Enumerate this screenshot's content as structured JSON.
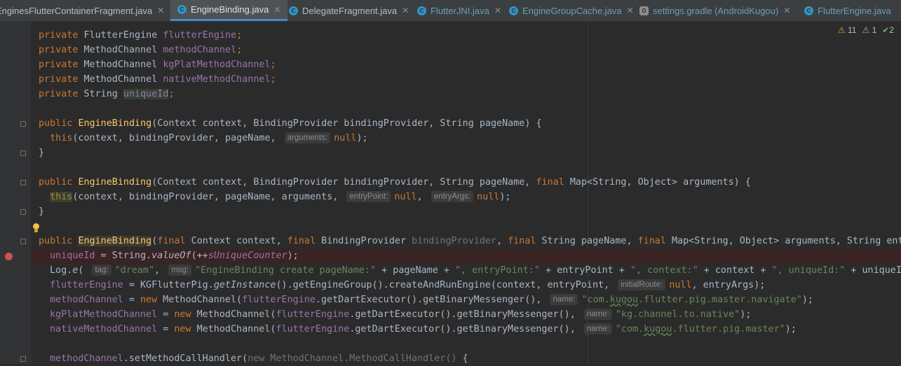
{
  "tabs": [
    {
      "label": "EnginesFlutterContainerFragment.java",
      "icon": "java-class-icon",
      "icon_color": "#3592c4",
      "active": false
    },
    {
      "label": "EngineBinding.java",
      "icon": "java-class-icon",
      "icon_color": "#3592c4",
      "active": true
    },
    {
      "label": "DelegateFragment.java",
      "icon": "java-class-icon",
      "icon_color": "#3592c4",
      "active": false
    },
    {
      "label": "FlutterJNI.java",
      "icon": "java-class-icon",
      "icon_color": "#3592c4",
      "active": false
    },
    {
      "label": "EngineGroupCache.java",
      "icon": "java-class-icon",
      "icon_color": "#3592c4",
      "active": false
    },
    {
      "label": "settings.gradle (AndroidKugou)",
      "icon": "gradle-icon",
      "icon_color": "#8c8c8c",
      "active": false
    },
    {
      "label": "FlutterEngine.java",
      "icon": "java-class-icon",
      "icon_color": "#3592c4",
      "active": false
    }
  ],
  "inspections": {
    "warnings": "11",
    "weak_warnings": "1",
    "typos": "2"
  },
  "code": {
    "l1": {
      "mod": "private",
      "type": "FlutterEngine",
      "name": "flutterEngine",
      "semi": ";"
    },
    "l2": {
      "mod": "private",
      "type": "MethodChannel",
      "name": "methodChannel",
      "semi": ";"
    },
    "l3": {
      "mod": "private",
      "type": "MethodChannel",
      "name": "kgPlatMethodChannel",
      "semi": ";"
    },
    "l4": {
      "mod": "private",
      "type": "MethodChannel",
      "name": "nativeMethodChannel",
      "semi": ";"
    },
    "l5": {
      "mod": "private",
      "type": "String",
      "name": "uniqueId",
      "semi": ";"
    },
    "c1": {
      "mod": "public",
      "name": "EngineBinding",
      "params": "(Context context, BindingProvider bindingProvider, String pageName) {"
    },
    "c1b": {
      "this": "this",
      "args": "(context, bindingProvider, pageName, ",
      "hint": "arguments:",
      "val": "null",
      "end": ");"
    },
    "brace": "}",
    "c2": {
      "mod": "public",
      "name": "EngineBinding",
      "params": "(Context context, BindingProvider bindingProvider, String pageName, ",
      "final": "final",
      "rest": " Map<String, Object> arguments) {"
    },
    "c2b": {
      "this": "this",
      "args": "(context, bindingProvider, pageName, arguments, ",
      "hint1": "entryPoint:",
      "val1": "null",
      "sep": ", ",
      "hint2": "entryArgs:",
      "val2": "null",
      "end": ");"
    },
    "c3": {
      "mod": "public",
      "name": "EngineBinding",
      "p1": "(",
      "f": "final",
      "t1": " Context context, ",
      "t2": " BindingProvider ",
      "unused": "bindingProvider",
      "t3": ", ",
      "t4": " String pageName, ",
      "t5": " Map<String, Object> arguments, String entr"
    },
    "b1": {
      "name": "uniqueId",
      "eq": " = String.",
      "fn": "valueOf",
      "p": "(++",
      "sfield": "sUniqueCounter",
      "end": ");"
    },
    "b2": {
      "cls": "Log.",
      "fn": "e",
      "p": "( ",
      "hint1": "tag:",
      "s1": "\"dream\"",
      "sep": ", ",
      "hint2": "msg:",
      "s2": "\"EngineBinding create pageName:\"",
      "c1": " + pageName + ",
      "s3": "\", entryPoint:\"",
      "c2": " + entryPoint + ",
      "s4": "\", context:\"",
      "c3": " + context + ",
      "s5": "\", uniqueId:\"",
      "c4": " + uniqueId"
    },
    "b3": {
      "name": "flutterEngine",
      "a": " = KGFlutterPig.",
      "fn": "getInstance",
      "b": "().getEngineGroup().createAndRunEngine(context, entryPoint, ",
      "hint": "initialRoute:",
      "val": "null",
      "end": ", entryArgs);"
    },
    "b4": {
      "name": "methodChannel",
      "eq": " = ",
      "new": "new",
      "a": " MethodChannel(",
      "fld": "flutterEngine",
      "b": ".getDartExecutor().getBinaryMessenger(), ",
      "hint": "name:",
      "s1": "\"com.",
      "sq": "kugou",
      "s2": ".flutter.pig.master.navigate\"",
      "end": ");"
    },
    "b5": {
      "name": "kgPlatMethodChannel",
      "eq": " = ",
      "new": "new",
      "a": " MethodChannel(",
      "fld": "flutterEngine",
      "b": ".getDartExecutor().getBinaryMessenger(), ",
      "hint": "name:",
      "s": "\"kg.channel.to.native\"",
      "end": ");"
    },
    "b6": {
      "name": "nativeMethodChannel",
      "eq": " = ",
      "new": "new",
      "a": " MethodChannel(",
      "fld": "flutterEngine",
      "b": ".getDartExecutor().getBinaryMessenger(), ",
      "hint": "name:",
      "s1": "\"com.",
      "sq": "kugou",
      "s2": ".flutter.pig.master\"",
      "end": ");"
    },
    "b7": {
      "name": "methodChannel",
      "a": ".setMethodCallHandler(",
      "new": "new",
      "dim": " MethodChannel.MethodCallHandler()",
      "end": " {"
    }
  }
}
